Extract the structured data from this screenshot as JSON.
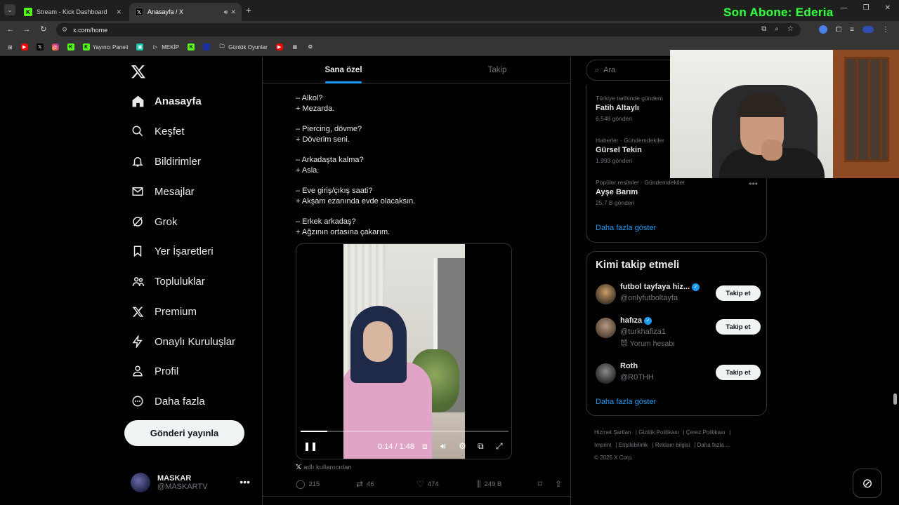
{
  "browser": {
    "tabs": [
      {
        "title": "Stream - Kick Dashboard",
        "icon": "kick-icon"
      },
      {
        "title": "Anasayfa / X",
        "icon": "x-icon",
        "active": true
      }
    ],
    "overlay_text": "Son Abone: Ederia",
    "url": "x.com/home",
    "bookmarks": [
      {
        "label": "",
        "icon": "youtube-icon"
      },
      {
        "label": "",
        "icon": "x-icon"
      },
      {
        "label": "",
        "icon": "instagram-icon"
      },
      {
        "label": "",
        "icon": "kick-icon"
      },
      {
        "label": "Yayıncı Paneli",
        "icon": "kick-icon"
      },
      {
        "label": "",
        "icon": "twitch-icon"
      },
      {
        "label": "MEKİP",
        "icon": "prime-icon"
      },
      {
        "label": "",
        "icon": "kick-icon"
      },
      {
        "label": "",
        "icon": "blue-square-icon"
      },
      {
        "label": "Günlük Oyunlar",
        "icon": "folder-icon"
      },
      {
        "label": "",
        "icon": "youtube-icon"
      },
      {
        "label": "",
        "icon": "game-icon"
      },
      {
        "label": "",
        "icon": "chatgpt-icon"
      }
    ]
  },
  "nav": {
    "items": [
      {
        "label": "Anasayfa",
        "icon": "home-icon",
        "active": true
      },
      {
        "label": "Keşfet",
        "icon": "search-icon"
      },
      {
        "label": "Bildirimler",
        "icon": "bell-icon"
      },
      {
        "label": "Mesajlar",
        "icon": "mail-icon"
      },
      {
        "label": "Grok",
        "icon": "grok-icon"
      },
      {
        "label": "Yer İşaretleri",
        "icon": "bookmark-icon"
      },
      {
        "label": "Topluluklar",
        "icon": "communities-icon"
      },
      {
        "label": "Premium",
        "icon": "x-icon"
      },
      {
        "label": "Onaylı Kuruluşlar",
        "icon": "lightning-icon"
      },
      {
        "label": "Profil",
        "icon": "profile-icon"
      },
      {
        "label": "Daha fazla",
        "icon": "more-icon"
      }
    ],
    "post_button": "Gönderi yayınla",
    "profile": {
      "name": "MASKAR",
      "handle": "@MASKARTV"
    }
  },
  "feed": {
    "tabs": [
      "Sana özel",
      "Takip"
    ],
    "tweet_lines": [
      [
        "– Alkol?",
        "+ Mezarda."
      ],
      [
        "– Piercing, dövme?",
        "+ Döverim seni."
      ],
      [
        "– Arkadaşta kalma?",
        "+ Asla."
      ],
      [
        "– Eve giriş/çıkış saati?",
        "+ Akşam ezanında evde olacaksın."
      ],
      [
        "– Erkek arkadaş?",
        "+ Ağzının ortasına çakarım."
      ]
    ],
    "video": {
      "time": "0:14 / 1:48",
      "progress_fraction": 0.13
    },
    "source": "adlı kullanıcıdan",
    "actions": {
      "replies": "215",
      "reposts": "46",
      "likes": "474",
      "views": "249 B"
    }
  },
  "right": {
    "search_placeholder": "Ara",
    "trends": [
      {
        "meta": "Türkiye tarihinde gündem",
        "name": "Fatih Altaylı",
        "count": "6.548 gönderi"
      },
      {
        "meta": "Haberler · Gündemdekiler",
        "name": "Gürsel Tekin",
        "count": "1.993 gönderi"
      },
      {
        "meta": "Popüler resimler · Gündemdekiler",
        "name": "Ayşe Barım",
        "count": "25,7 B gönderi"
      }
    ],
    "show_more": "Daha fazla göster",
    "who_title": "Kimi takip etmeli",
    "who": [
      {
        "name": "futbol tayfaya hiz...",
        "handle": "@onlyfutboltayfa",
        "verified": true,
        "extra": ""
      },
      {
        "name": "hafıza",
        "handle": "@turkhafiza1",
        "verified": true,
        "extra": "Yorum hesabı"
      },
      {
        "name": "Roth",
        "handle": "@R0THH",
        "verified": false,
        "extra": ""
      }
    ],
    "follow_label": "Takip et",
    "footer": [
      "Hizmet Şartları",
      "Gizlilik Politikası",
      "Çerez Politikası",
      "Imprint",
      "Erişilebilirlik",
      "Reklam bilgisi",
      "Daha fazla ...",
      "© 2025 X Corp."
    ]
  }
}
